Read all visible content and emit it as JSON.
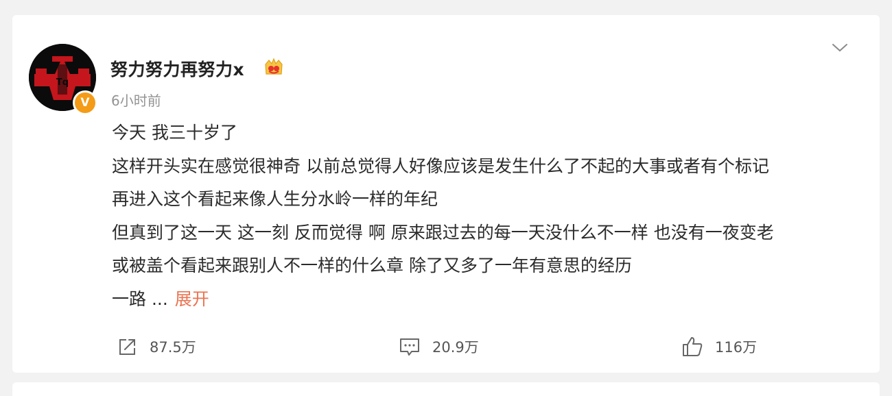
{
  "post": {
    "author": "努力努力再努力x",
    "time": "6小时前",
    "lines": [
      "今天 我三十岁了",
      "这样开头实在感觉很神奇 以前总觉得人好像应该是发生什么了不起的大事或者有个标记",
      "再进入这个看起来像人生分水岭一样的年纪",
      "但真到了这一天 这一刻 反而觉得 啊 原来跟过去的每一天没什么不一样 也没有一夜变老",
      "或被盖个看起来跟别人不一样的什么章 除了又多了一年有意思的经历"
    ],
    "last_line": "一路 ...",
    "expand_label": "展开",
    "verified_mark": "V",
    "avatar_text": "Tq"
  },
  "actions": {
    "share_count": "87.5万",
    "comment_count": "20.9万",
    "like_count": "116万"
  },
  "icons": [
    "chevron-down-icon",
    "vip-crown-icon",
    "verified-icon",
    "share-icon",
    "comment-icon",
    "like-icon"
  ],
  "colors": {
    "accent": "#eb7350",
    "verified": "#f49b17",
    "avatar_red": "#c4161c",
    "muted_text": "#939393"
  }
}
